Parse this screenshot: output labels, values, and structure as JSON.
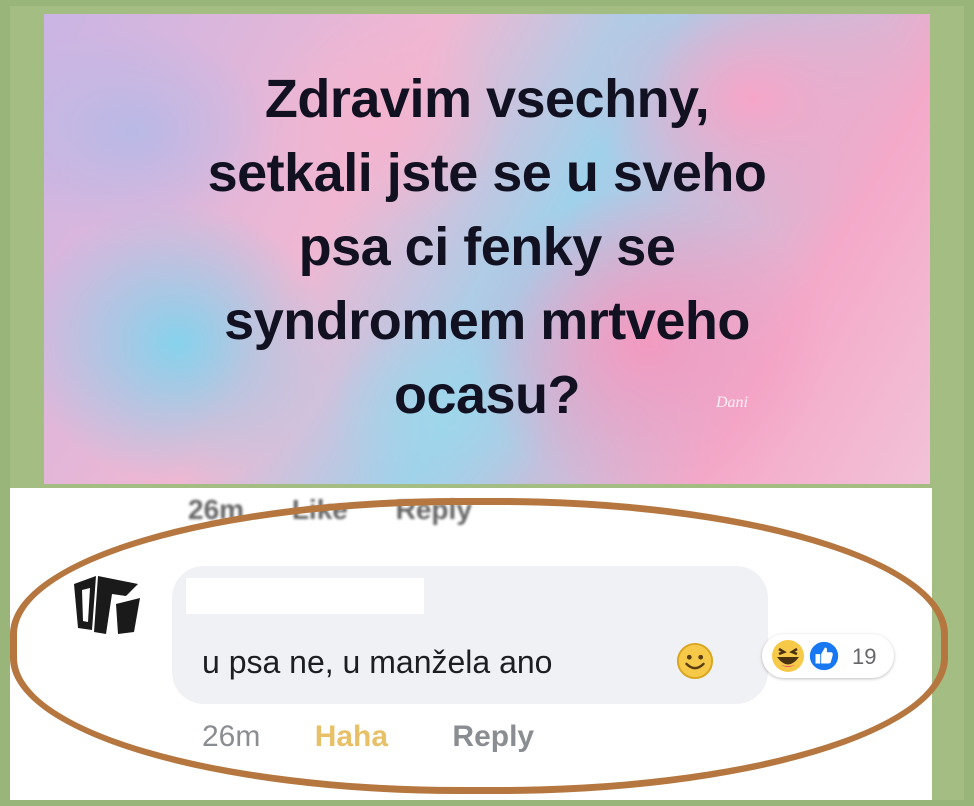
{
  "post": {
    "lines": [
      "Zdravim vsechny,",
      "setkali jste se u sveho",
      "psa ci fenky se",
      "syndromem mrtveho",
      "ocasu?"
    ],
    "watermark": "Dani"
  },
  "previous_comment_meta": {
    "time": "26m",
    "like": "Like",
    "reply": "Reply"
  },
  "comment": {
    "text": "u psa ne, u manžela ano",
    "emoji": "smiling-face-icon",
    "reactions": {
      "icons": [
        "haha-reaction-icon",
        "like-reaction-icon"
      ],
      "count": "19"
    },
    "time": "26m",
    "reaction_label": "Haha",
    "reply_label": "Reply"
  },
  "colors": {
    "background": "#9ab57a",
    "highlight_ring": "#b5773f",
    "bubble": "#f0f1f4",
    "haha": "#e8c067",
    "like_blue": "#1877f2"
  }
}
